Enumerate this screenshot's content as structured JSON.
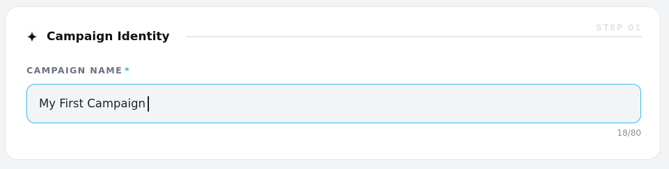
{
  "step_label": "STEP 01",
  "section": {
    "title": "Campaign Identity",
    "icon": "sparkle-icon"
  },
  "field": {
    "label": "CAMPAIGN NAME",
    "required_marker": "*",
    "value": "My First Campaign",
    "counter": "18/80"
  },
  "colors": {
    "accent": "#2cc3dc",
    "required": "#21b8d6",
    "input_bg": "#f3f4f6",
    "card_bg": "#ffffff"
  }
}
